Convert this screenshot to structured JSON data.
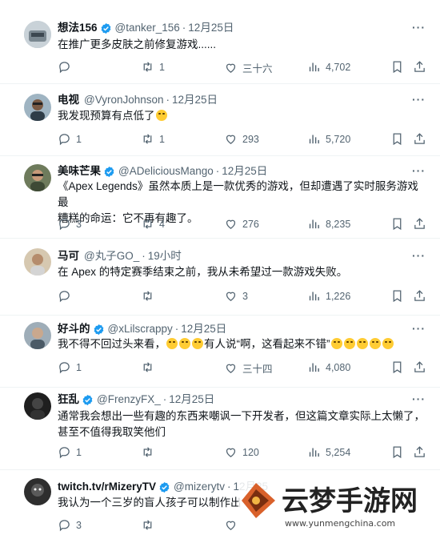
{
  "tweets": [
    {
      "name": "想法156",
      "handle": "@tanker_156",
      "date": "12月25日",
      "lines": [
        "在推广更多皮肤之前修复游戏......"
      ],
      "reply": "",
      "retweet": "1",
      "like": "三十六",
      "views": "4,702",
      "avatar_color": "#b9c3c9"
    },
    {
      "name": "电视",
      "handle": "@VyronJohnson",
      "date": "12月25日",
      "lines": [
        "我发现预算有点低了"
      ],
      "reply": "1",
      "retweet": "1",
      "like": "293",
      "views": "5,720",
      "avatar_color": "#6b7f8c"
    },
    {
      "name": "美味芒果",
      "handle": "@ADeliciousMango",
      "date": "12月25日",
      "lines": [
        "《Apex Legends》虽然本质上是一款优秀的游戏，但却遭遇了实时服务游戏最",
        "糟糕的命运：它不再有趣了。"
      ],
      "reply": "3",
      "retweet": "4",
      "like": "276",
      "views": "8,235",
      "avatar_color": "#5d6b4c"
    },
    {
      "name": "马可",
      "handle": "@丸子GO_",
      "date": "19小时",
      "lines": [
        "在 Apex 的特定赛季结束之前，我从未希望过一款游戏失败。"
      ],
      "reply": "",
      "retweet": "",
      "like": "3",
      "views": "1,226",
      "avatar_color": "#c7b49a"
    },
    {
      "name": "好斗的",
      "handle": "@xLilscrappy",
      "date": "12月25日",
      "line_pre": "我不得不回过头来看，",
      "line_mid": "有人说“啊，这看起来不错”",
      "reply": "1",
      "retweet": "",
      "like": "三十四",
      "views": "4,080",
      "avatar_color": "#8a9aa6"
    },
    {
      "name": "狂乱",
      "handle": "@FrenzyFX_",
      "date": "12月25日",
      "lines": [
        "通常我会想出一些有趣的东西来嘲讽一下开发者，但这篇文章实际上太懒了，",
        "甚至不值得我取笑他们"
      ],
      "reply": "1",
      "retweet": "",
      "like": "120",
      "views": "5,254",
      "avatar_color": "#2a2a2a"
    },
    {
      "name": "twitch.tv/rMizeryTV",
      "handle": "@mizerytv",
      "date": "12月25",
      "lines": [
        "我认为一个三岁的盲人孩子可以制作出"
      ],
      "reply": "3",
      "retweet": "",
      "like": "",
      "views": "",
      "avatar_color": "#3b3b3b"
    }
  ],
  "watermark": {
    "title": "云梦手游网",
    "url": "www.yunmengchina.com"
  },
  "colors": {
    "accent": "#1d9bf0",
    "muted": "#536471",
    "divider": "#eff3f4"
  }
}
